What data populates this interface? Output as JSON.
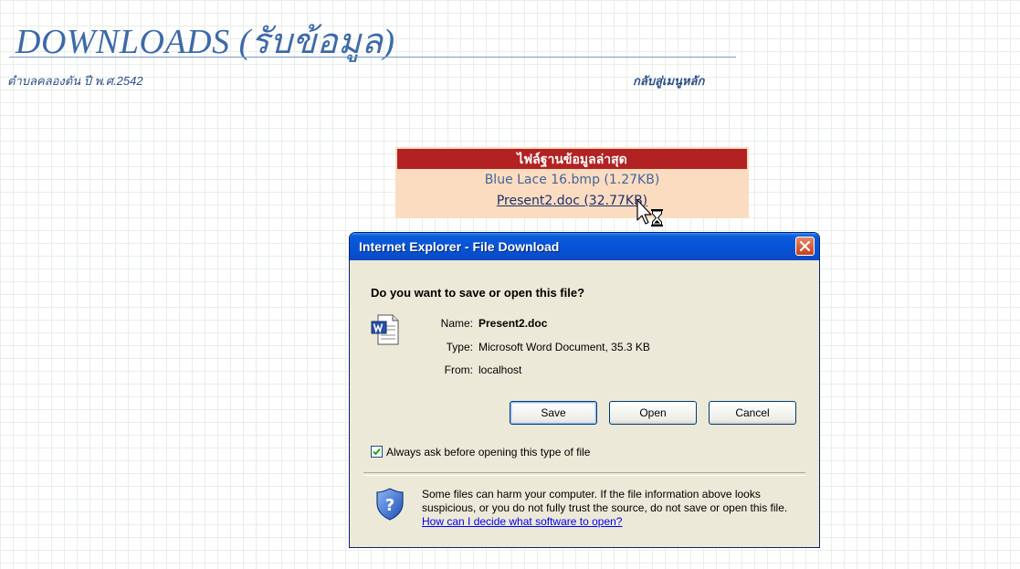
{
  "page": {
    "title": "DOWNLOADS (รับข้อมูล)",
    "subtitle": "ตำบลคลองตัน ปี พ.ศ.2542",
    "home_link": "กลับสู่เมนูหลัก"
  },
  "file_box": {
    "header": "ไฟล์ฐานข้อมูลล่าสุด",
    "files": [
      "Blue Lace 16.bmp (1.27KB)",
      "Present2.doc (32.77KB)"
    ]
  },
  "dialog": {
    "title": "Internet Explorer - File Download",
    "question": "Do you want to save or open this file?",
    "name_label": "Name:",
    "name_value": "Present2.doc",
    "type_label": "Type:",
    "type_value": "Microsoft Word Document, 35.3 KB",
    "from_label": "From:",
    "from_value": "localhost",
    "save_label": "Save",
    "open_label": "Open",
    "cancel_label": "Cancel",
    "checkbox_label": "Always ask before opening this type of file",
    "checkbox_checked": true,
    "warning_text": "Some files can harm your computer. If the file information above looks suspicious, or you do not fully trust the source, do not save or open this file.",
    "warning_link": "How can I decide what software to open?"
  },
  "icons": {
    "file_type": "word-document-icon",
    "warning": "shield-question-icon",
    "close": "close-icon",
    "cursor": "busy-cursor-icon"
  },
  "colors": {
    "title_blue": "#3d6aa8",
    "header_red": "#b22222",
    "box_peach": "#fbdcc0",
    "titlebar_blue": "#0552d6",
    "close_red": "#c7401b"
  }
}
